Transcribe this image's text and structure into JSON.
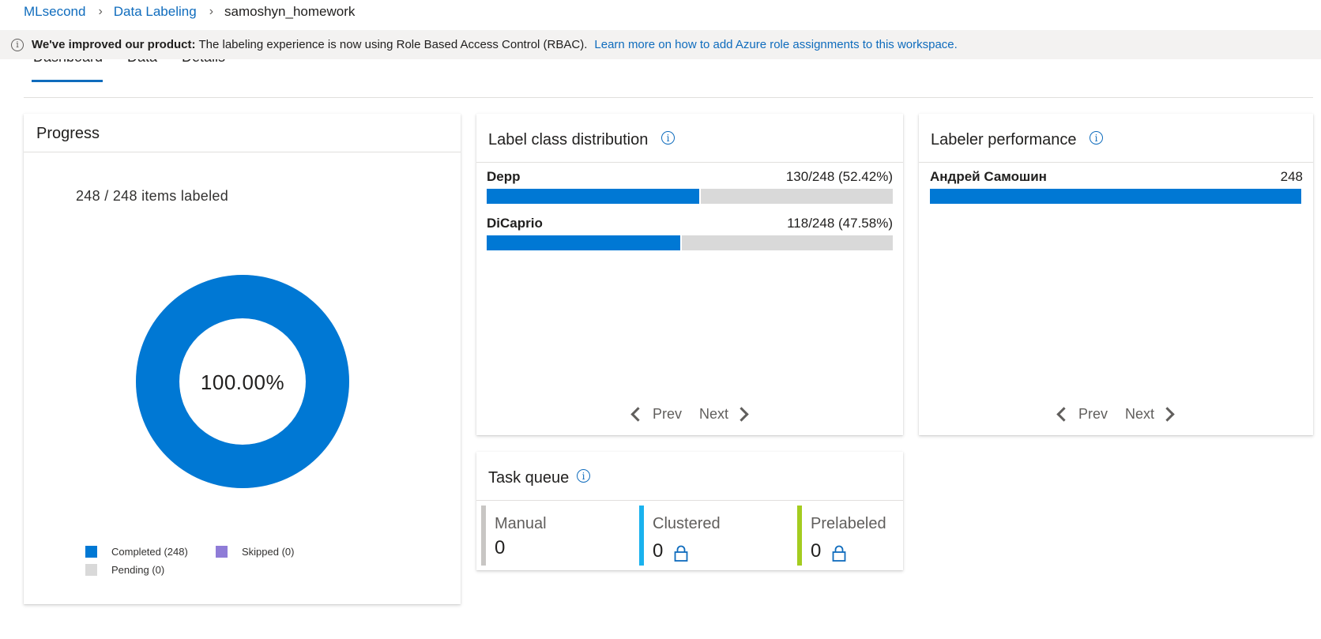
{
  "breadcrumb": {
    "items": [
      "MLsecond",
      "Data Labeling",
      "samoshyn_homework"
    ]
  },
  "banner": {
    "bold_text": "We've improved our product:",
    "text": "The labeling experience is now using Role Based Access Control (RBAC).",
    "link_text": "Learn more on how to add Azure role assignments to this workspace."
  },
  "tabs": [
    {
      "label": "Dashboard",
      "selected": true
    },
    {
      "label": "Data",
      "selected": false
    },
    {
      "label": "Details",
      "selected": false
    }
  ],
  "progress": {
    "title": "Progress",
    "items_labeled": "248 / 248 items labeled",
    "percent_text": "100.00%",
    "completed_fraction": 1.0,
    "legend": [
      {
        "label": "Completed (248)",
        "color": "#0078d4"
      },
      {
        "label": "Skipped (0)",
        "color": "#8f7cd7"
      },
      {
        "label": "Pending (0)",
        "color": "#d9d9d9"
      }
    ]
  },
  "label_class_distribution": {
    "title": "Label class distribution",
    "rows": [
      {
        "name": "Depp",
        "value_text": "130/248 (52.42%)",
        "fraction": 0.5242
      },
      {
        "name": "DiCaprio",
        "value_text": "118/248 (47.58%)",
        "fraction": 0.4758
      }
    ],
    "prev_label": "Prev",
    "next_label": "Next"
  },
  "labeler_performance": {
    "title": "Labeler performance",
    "rows": [
      {
        "name": "Андрей Самошин",
        "value_text": "248",
        "fraction": 1.0
      }
    ],
    "prev_label": "Prev",
    "next_label": "Next"
  },
  "task_queue": {
    "title": "Task queue",
    "columns": [
      {
        "label": "Manual",
        "value": "0",
        "color": "#c8c6c4",
        "locked": false
      },
      {
        "label": "Clustered",
        "value": "0",
        "color": "#1ab2ee",
        "locked": true
      },
      {
        "label": "Prelabeled",
        "value": "0",
        "color": "#a4cc1f",
        "locked": true
      }
    ]
  },
  "colors": {
    "accent": "#0078d4",
    "link": "#0f6cbd",
    "track": "#d9d9d9"
  }
}
